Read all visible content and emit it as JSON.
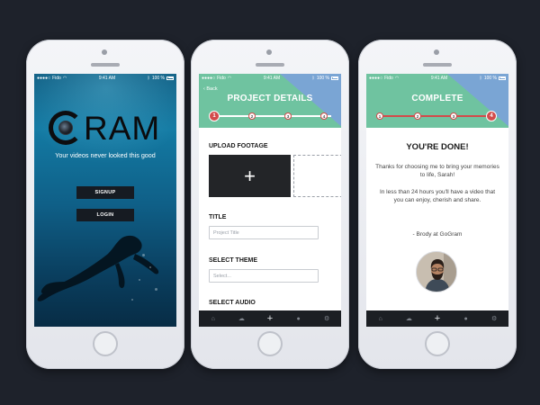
{
  "screen1": {
    "status": {
      "carrier": "Fido",
      "time": "9:41 AM",
      "battery": "100 %"
    },
    "logo_text": "RAM",
    "tagline": "Your videos never looked this good",
    "signup_label": "SIGNUP",
    "login_label": "LOGIN"
  },
  "screen2": {
    "status": {
      "carrier": "Fido",
      "time": "9:41 AM",
      "battery": "100 %"
    },
    "back_label": "Back",
    "title": "PROJECT DETAILS",
    "steps": [
      "1",
      "2",
      "3",
      "4"
    ],
    "current_step": 1,
    "upload_label": "UPLOAD FOOTAGE",
    "upload_plus": "+",
    "title_label": "TITLE",
    "title_placeholder": "Project Title",
    "theme_label": "SELECT THEME",
    "theme_placeholder": "Select...",
    "audio_label": "SELECT AUDIO",
    "tabs": [
      "home-icon",
      "cloud-icon",
      "plus-icon",
      "user-icon",
      "gear-icon"
    ],
    "plus_glyph": "+"
  },
  "screen3": {
    "status": {
      "carrier": "Fido",
      "time": "9:41 AM",
      "battery": "100 %"
    },
    "title": "COMPLETE",
    "steps": [
      "1",
      "2",
      "3",
      "4"
    ],
    "current_step": 4,
    "done_title": "YOU'RE DONE!",
    "para1": "Thanks for choosing me to bring your memories to life, Sarah!",
    "para2": "In less than 24 hours you'll have a video that you can enjoy, cherish and share.",
    "signature": "- Brody at GoGram",
    "plus_glyph": "+"
  },
  "colors": {
    "header_green": "#6fc3a0",
    "header_blue": "#7aa5d4",
    "step_red": "#d24b4b",
    "tabbar": "#1c1f24",
    "background": "#1e222b"
  }
}
